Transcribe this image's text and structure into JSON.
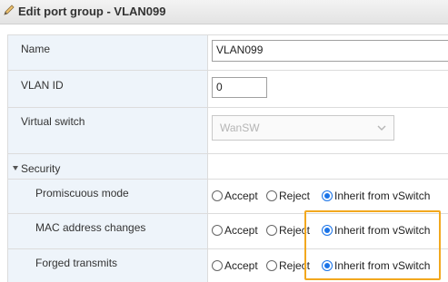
{
  "title": "Edit port group - VLAN099",
  "title_icon": "pencil-icon",
  "fields": {
    "name": {
      "label": "Name",
      "value": "VLAN099"
    },
    "vlan_id": {
      "label": "VLAN ID",
      "value": "0"
    },
    "virtual_switch": {
      "label": "Virtual switch",
      "value": "WanSW"
    }
  },
  "security": {
    "label": "Security",
    "rows": [
      {
        "label": "Promiscuous mode",
        "options": [
          "Accept",
          "Reject",
          "Inherit from vSwitch"
        ],
        "selected": "Inherit from vSwitch"
      },
      {
        "label": "MAC address changes",
        "options": [
          "Accept",
          "Reject",
          "Inherit from vSwitch"
        ],
        "selected": "Inherit from vSwitch"
      },
      {
        "label": "Forged transmits",
        "options": [
          "Accept",
          "Reject",
          "Inherit from vSwitch"
        ],
        "selected": "Inherit from vSwitch"
      }
    ]
  },
  "colors": {
    "accent": "#1a73e8",
    "highlight_box": "#f2a81e",
    "label_background": "#eef4fa"
  }
}
